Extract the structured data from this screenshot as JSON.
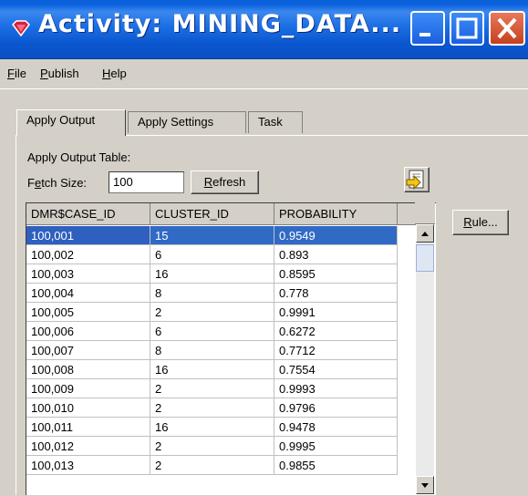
{
  "window": {
    "title": "Activity: MINING_DATA...",
    "icon": "ruby-gem-icon",
    "controls": [
      "minimize-icon",
      "maximize-icon",
      "close-icon"
    ]
  },
  "menu": {
    "file": {
      "u": "F",
      "rest": "ile"
    },
    "publish": {
      "u": "P",
      "rest": "ublish"
    },
    "help": {
      "u": "H",
      "rest": "elp"
    }
  },
  "tabs": [
    "Apply Output",
    "Apply Settings",
    "Task"
  ],
  "output": {
    "table_label": "Apply Output Table:",
    "fetch_label_pre": "F",
    "fetch_label_u": "e",
    "fetch_label_post": "tch Size:",
    "fetch_size": "100",
    "refresh_u": "R",
    "refresh_rest": "efresh",
    "rule_u": "R",
    "rule_rest": "ule...",
    "export_icon": "export-icon"
  },
  "table": {
    "columns": [
      "DMR$CASE_ID",
      "CLUSTER_ID",
      "PROBABILITY"
    ],
    "selected_row": 0,
    "rows": [
      [
        "100,001",
        "15",
        "0.9549"
      ],
      [
        "100,002",
        "6",
        "0.893"
      ],
      [
        "100,003",
        "16",
        "0.8595"
      ],
      [
        "100,004",
        "8",
        "0.778"
      ],
      [
        "100,005",
        "2",
        "0.9991"
      ],
      [
        "100,006",
        "6",
        "0.6272"
      ],
      [
        "100,007",
        "8",
        "0.7712"
      ],
      [
        "100,008",
        "16",
        "0.7554"
      ],
      [
        "100,009",
        "2",
        "0.9993"
      ],
      [
        "100,010",
        "2",
        "0.9796"
      ],
      [
        "100,011",
        "16",
        "0.9478"
      ],
      [
        "100,012",
        "2",
        "0.9995"
      ],
      [
        "100,013",
        "2",
        "0.9855"
      ]
    ]
  },
  "colors": {
    "titlebar": "#0b61de",
    "selection": "#316ac5",
    "close_button": "#d4512c",
    "face": "#d4d0c8"
  }
}
